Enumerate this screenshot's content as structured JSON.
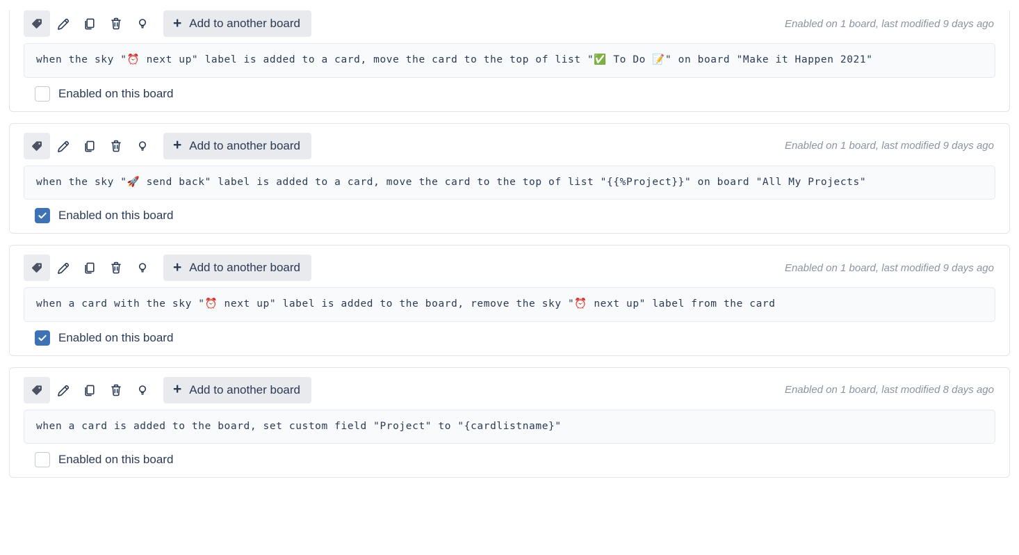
{
  "toolbar": {
    "icons": [
      {
        "name": "tag-icon",
        "active": true
      },
      {
        "name": "pencil-icon",
        "active": false
      },
      {
        "name": "copy-icon",
        "active": false
      },
      {
        "name": "trash-icon",
        "active": false
      },
      {
        "name": "lightbulb-icon",
        "active": false
      }
    ],
    "add_board_label": "Add to another board",
    "plus_glyph": "+"
  },
  "labels": {
    "enabled_on_this_board": "Enabled on this board"
  },
  "colors": {
    "checkbox_checked": "#3d72b4",
    "card_border": "#e2e4e8",
    "rule_box_bg": "#f8fafb",
    "button_bg": "#e8eaed",
    "text": "#2b3a55",
    "meta_text": "#8b94a3"
  },
  "rules": [
    {
      "meta": "Enabled on 1 board, last modified 9 days ago",
      "text": "when the sky \"⏰ next up\" label is added to a card, move the card to the top of list \"✅ To Do 📝\" on board \"Make it Happen 2021\"",
      "enabled_label": "Enabled on this board",
      "enabled": false,
      "clipped_top": true
    },
    {
      "meta": "Enabled on 1 board, last modified 9 days ago",
      "text": "when the sky \"🚀 send back\" label is added to a card, move the card to the top of list \"{{%Project}}\" on board \"All My Projects\"",
      "enabled_label": "Enabled on this board",
      "enabled": true,
      "clipped_top": false
    },
    {
      "meta": "Enabled on 1 board, last modified 9 days ago",
      "text": "when a card with the sky \"⏰ next up\" label is added to the board, remove the sky \"⏰ next up\" label from the card",
      "enabled_label": "Enabled on this board",
      "enabled": true,
      "clipped_top": false
    },
    {
      "meta": "Enabled on 1 board, last modified 8 days ago",
      "text": "when a card is added to the board, set custom field \"Project\" to \"{cardlistname}\"",
      "enabled_label": "Enabled on this board",
      "enabled": false,
      "clipped_top": false
    }
  ]
}
